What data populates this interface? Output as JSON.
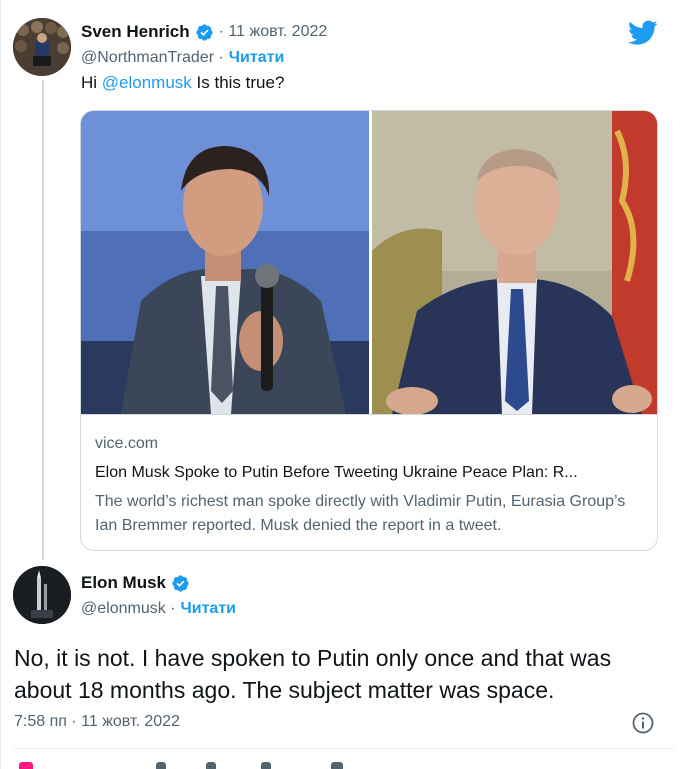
{
  "quoted_tweet": {
    "author_name": "Sven Henrich",
    "date": "· 11 жовт. 2022",
    "handle": "@NorthmanTrader ·",
    "follow_label": "Читати",
    "text_prefix": "Hi ",
    "mention": "@elonmusk",
    "text_suffix": " Is this true?"
  },
  "card": {
    "domain": "vice.com",
    "title": "Elon Musk Spoke to Putin Before Tweeting Ukraine Peace Plan: R...",
    "description": "The world’s richest man spoke directly with Vladimir Putin, Eurasia Group’s Ian Bremmer reported. Musk denied the report in a tweet."
  },
  "reply_tweet": {
    "author_name": "Elon Musk",
    "handle": "@elonmusk ·",
    "follow_label": "Читати",
    "text": "No, it is not. I have spoken to Putin only once and that was about 18 months ago. The subject matter was space.",
    "timestamp": "7:58 пп · 11 жовт. 2022"
  },
  "colors": {
    "accent": "#1d9bf0",
    "like": "#f91880",
    "text_primary": "#0f1419",
    "text_secondary": "#536471"
  },
  "icons": [
    "twitter-bird-icon",
    "verified-badge-icon",
    "info-icon"
  ]
}
